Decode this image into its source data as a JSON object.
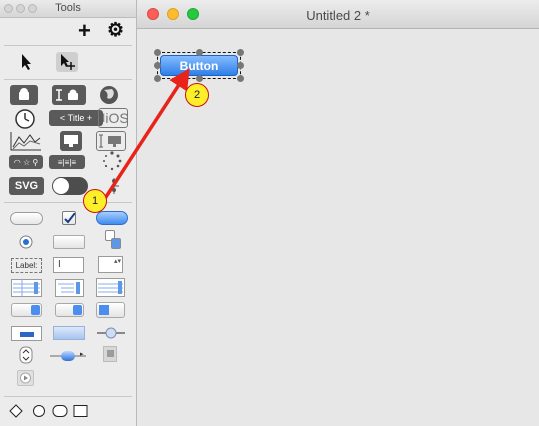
{
  "tools_panel": {
    "title": "Tools",
    "add_symbol": "+",
    "gear_symbol": "⚙",
    "title_segment_label": "Title",
    "ios_label": "iOS",
    "label_sample": "Label:",
    "svg_label": "SVG"
  },
  "document": {
    "title": "Untitled 2 *",
    "button_label": "Button"
  },
  "annotations": {
    "step1": "1",
    "step2": "2",
    "arrow_color": "#e8231a",
    "marker_color": "#ffef2a"
  },
  "colors": {
    "close": "#fc5f57",
    "minimize": "#fdbc2e",
    "zoom": "#28c840",
    "button_blue": "#2f7fe8"
  }
}
